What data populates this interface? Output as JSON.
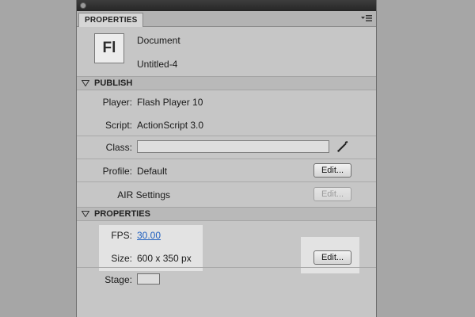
{
  "panel": {
    "tab_label": "PROPERTIES"
  },
  "document": {
    "icon_text": "Fl",
    "type_label": "Document",
    "name": "Untitled-4"
  },
  "publish": {
    "header": "PUBLISH",
    "player_label": "Player:",
    "player_value": "Flash Player 10",
    "script_label": "Script:",
    "script_value": "ActionScript 3.0",
    "class_label": "Class:",
    "class_value": "",
    "profile_label": "Profile:",
    "profile_value": "Default",
    "profile_edit": "Edit...",
    "air_label": "AIR Settings",
    "air_edit": "Edit..."
  },
  "properties": {
    "header": "PROPERTIES",
    "fps_label": "FPS:",
    "fps_value": "30.00",
    "size_label": "Size:",
    "size_value": "600 x 350 px",
    "size_edit": "Edit...",
    "stage_label": "Stage:"
  },
  "colors": {
    "background": "#a6a6a6",
    "panel": "#c6c6c6",
    "link": "#1f5fbf",
    "highlight": "#e3e3e3"
  }
}
